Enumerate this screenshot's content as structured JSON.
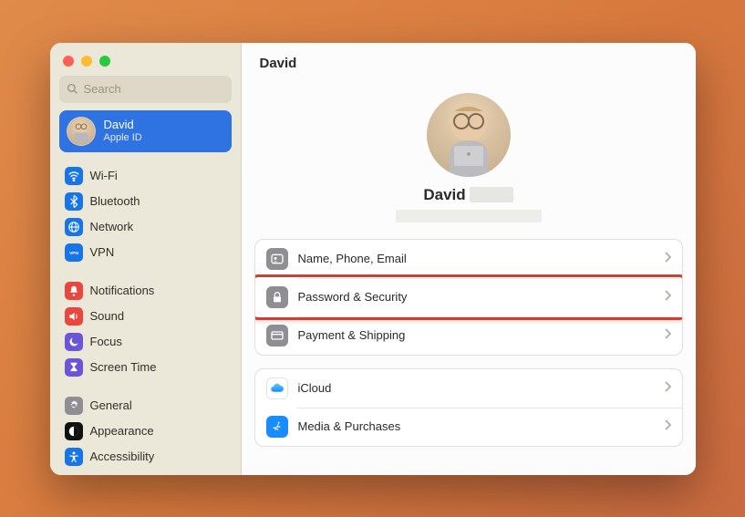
{
  "window_title": "David",
  "search": {
    "placeholder": "Search"
  },
  "account": {
    "name": "David",
    "sub": "Apple ID"
  },
  "sidebar_groups": [
    {
      "items": [
        {
          "id": "wifi",
          "label": "Wi-Fi",
          "icon": "wifi",
          "bg": "#1775e8"
        },
        {
          "id": "bluetooth",
          "label": "Bluetooth",
          "icon": "bluetooth",
          "bg": "#1775e8"
        },
        {
          "id": "network",
          "label": "Network",
          "icon": "globe",
          "bg": "#1775e8"
        },
        {
          "id": "vpn",
          "label": "VPN",
          "icon": "vpn",
          "bg": "#1775e8"
        }
      ]
    },
    {
      "items": [
        {
          "id": "notifications",
          "label": "Notifications",
          "icon": "bell",
          "bg": "#e9463f"
        },
        {
          "id": "sound",
          "label": "Sound",
          "icon": "speaker",
          "bg": "#e9463f"
        },
        {
          "id": "focus",
          "label": "Focus",
          "icon": "moon",
          "bg": "#6a55d8"
        },
        {
          "id": "screentime",
          "label": "Screen Time",
          "icon": "hourglass",
          "bg": "#6a55d8"
        }
      ]
    },
    {
      "items": [
        {
          "id": "general",
          "label": "General",
          "icon": "gear",
          "bg": "#8e8e93"
        },
        {
          "id": "appearance",
          "label": "Appearance",
          "icon": "appearance",
          "bg": "#111"
        },
        {
          "id": "accessibility",
          "label": "Accessibility",
          "icon": "accessibility",
          "bg": "#1775e8"
        }
      ]
    }
  ],
  "profile": {
    "name": "David"
  },
  "settings_sections": [
    {
      "rows": [
        {
          "id": "name-phone-email",
          "label": "Name, Phone, Email",
          "icon": "id-card",
          "bg": "#8e8e93",
          "highlight": false
        },
        {
          "id": "password-security",
          "label": "Password & Security",
          "icon": "lock",
          "bg": "#8e8e93",
          "highlight": true
        },
        {
          "id": "payment-shipping",
          "label": "Payment & Shipping",
          "icon": "credit-card",
          "bg": "#8e8e93",
          "highlight": false
        }
      ]
    },
    {
      "rows": [
        {
          "id": "icloud",
          "label": "iCloud",
          "icon": "cloud",
          "bg": "#ffffff",
          "highlight": false
        },
        {
          "id": "media-purchases",
          "label": "Media & Purchases",
          "icon": "appstore",
          "bg": "#1a8cff",
          "highlight": false
        }
      ]
    }
  ]
}
